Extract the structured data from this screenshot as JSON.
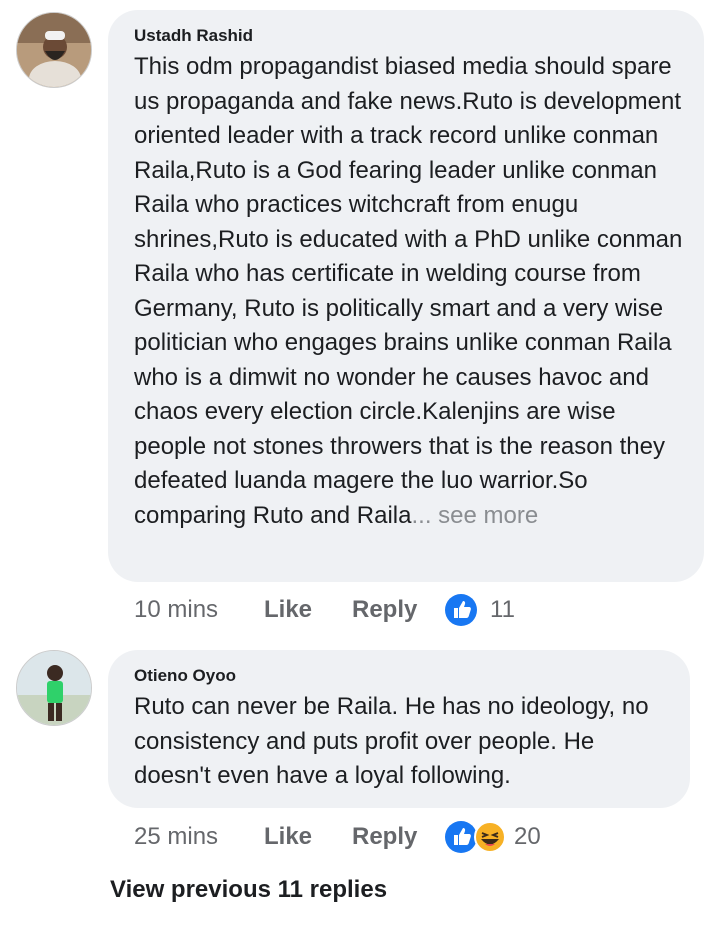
{
  "comments": [
    {
      "author": "Ustadh Rashid",
      "text": "This odm propagandist biased media should spare us propaganda and fake news.Ruto is development oriented leader with a track record unlike conman Raila,Ruto is a God fearing leader unlike conman Raila who practices witchcraft from enugu shrines,Ruto is educated with a PhD unlike conman Raila who has certificate in welding course from Germany, Ruto is politically smart and a very wise politician who engages brains unlike conman Raila who is a dimwit no wonder he causes havoc and chaos every election circle.Kalenjins are wise people not stones throwers that is the reason they defeated luanda magere the luo warrior.So comparing Ruto and Raila",
      "see_more": "... see more",
      "time": "10 mins",
      "like_label": "Like",
      "reply_label": "Reply",
      "reaction_count": "11",
      "reactions": [
        "like-icon"
      ]
    },
    {
      "author": "Otieno Oyoo",
      "text": "Ruto can never be Raila. He has no ideology, no consistency and puts profit over people. He doesn't even have a loyal following.",
      "time": "25 mins",
      "like_label": "Like",
      "reply_label": "Reply",
      "reaction_count": "20",
      "reactions": [
        "like-icon",
        "laugh-icon"
      ]
    }
  ],
  "view_previous": "View previous 11 replies",
  "colors": {
    "bubble": "#eff1f4",
    "like_blue": "#1877f2",
    "meta_gray": "#65676b",
    "laugh_yellow": "#f7b125"
  }
}
